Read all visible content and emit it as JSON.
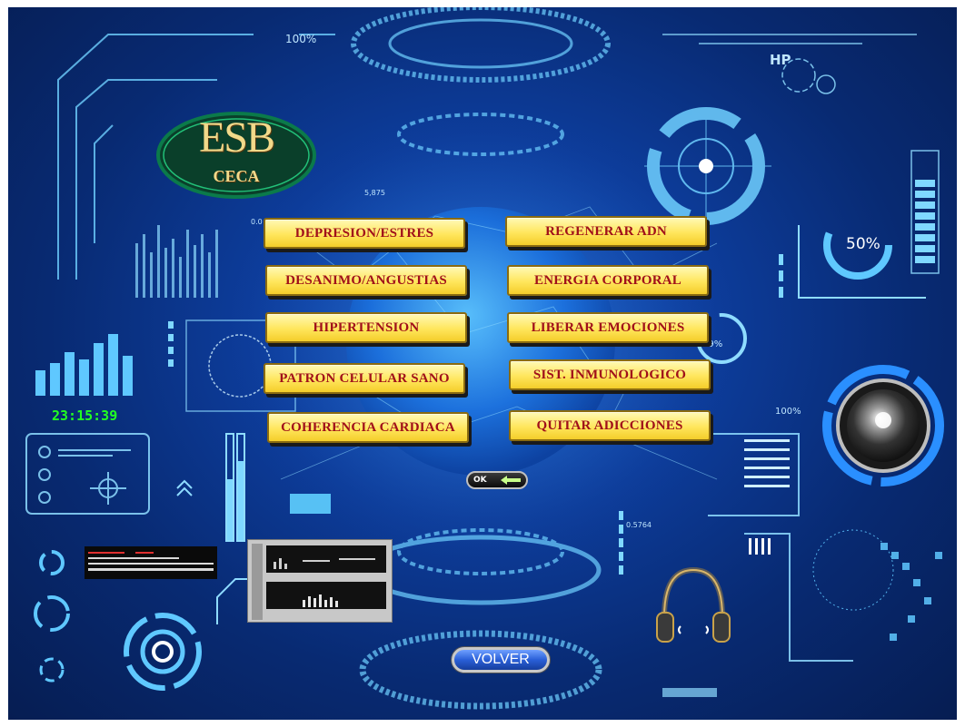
{
  "hud": {
    "pct_top": "100%",
    "hp_label": "HP",
    "pct_ring": "50%",
    "pct_small": "79%",
    "pct_right": "100%",
    "value_a": "5,875",
    "value_b": "0.5764",
    "value_c": "0.0"
  },
  "logo": {
    "main": "ESB",
    "sub": "CECA"
  },
  "clock": "23:15:39",
  "buttons_left": [
    "DEPRESION/ESTRES",
    "DESANIMO/ANGUSTIAS",
    "HIPERTENSION",
    "PATRON CELULAR SANO",
    "COHERENCIA CARDIACA"
  ],
  "buttons_right": [
    "REGENERAR ADN",
    "ENERGIA CORPORAL",
    "LIBERAR EMOCIONES",
    "SIST. INMUNOLOGICO",
    "QUITAR ADICCIONES"
  ],
  "ok_button": "OK",
  "volver_button": "VOLVER",
  "colors": {
    "background": "#0d3c9a",
    "button_fill": "#ffe65c",
    "button_text": "#a0101a",
    "clock": "#22ff22",
    "hud_cyan": "#7fd8ff"
  },
  "icons": [
    "headphones-icon",
    "speaker-icon",
    "arrow-left-icon",
    "globe-icon",
    "radar-icon"
  ]
}
